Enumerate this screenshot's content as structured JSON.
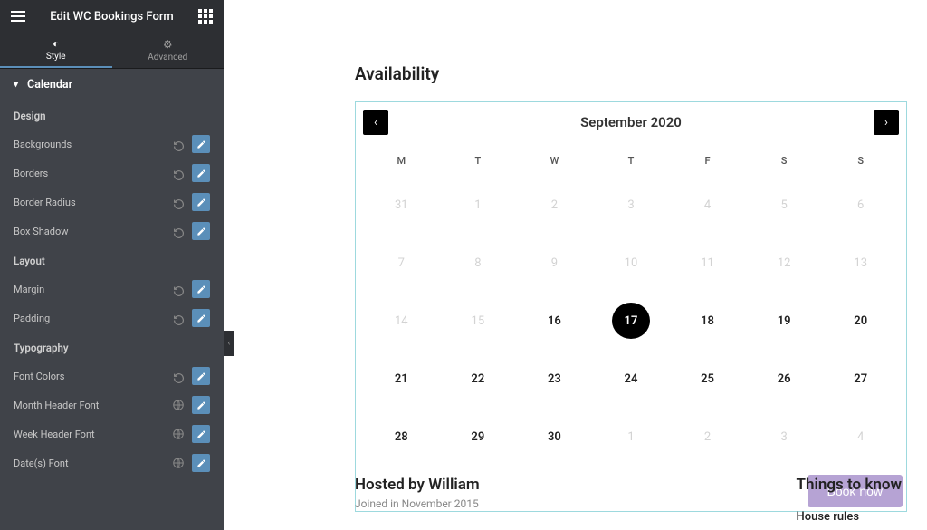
{
  "header": {
    "title": "Edit WC Bookings Form"
  },
  "tabs": {
    "style": "Style",
    "advanced": "Advanced"
  },
  "accordion": {
    "calendar": "Calendar"
  },
  "sections": {
    "design_label": "Design",
    "layout_label": "Layout",
    "typography_label": "Typography"
  },
  "props": {
    "backgrounds": "Backgrounds",
    "borders": "Borders",
    "border_radius": "Border Radius",
    "box_shadow": "Box Shadow",
    "margin": "Margin",
    "padding": "Padding",
    "font_colors": "Font Colors",
    "month_header_font": "Month Header Font",
    "week_header_font": "Week Header Font",
    "dates_font": "Date(s) Font"
  },
  "canvas": {
    "availability": "Availability",
    "month": "September 2020",
    "day_headers": [
      "M",
      "T",
      "W",
      "T",
      "F",
      "S",
      "S"
    ],
    "days": [
      {
        "n": "31",
        "s": "disabled"
      },
      {
        "n": "1",
        "s": "disabled"
      },
      {
        "n": "2",
        "s": "disabled"
      },
      {
        "n": "3",
        "s": "disabled"
      },
      {
        "n": "4",
        "s": "disabled"
      },
      {
        "n": "5",
        "s": "disabled"
      },
      {
        "n": "6",
        "s": "disabled"
      },
      {
        "n": "7",
        "s": "disabled"
      },
      {
        "n": "8",
        "s": "disabled"
      },
      {
        "n": "9",
        "s": "disabled"
      },
      {
        "n": "10",
        "s": "disabled"
      },
      {
        "n": "11",
        "s": "disabled"
      },
      {
        "n": "12",
        "s": "disabled"
      },
      {
        "n": "13",
        "s": "disabled"
      },
      {
        "n": "14",
        "s": "disabled"
      },
      {
        "n": "15",
        "s": "disabled"
      },
      {
        "n": "16",
        "s": "active"
      },
      {
        "n": "17",
        "s": "selected"
      },
      {
        "n": "18",
        "s": "active"
      },
      {
        "n": "19",
        "s": "active"
      },
      {
        "n": "20",
        "s": "active"
      },
      {
        "n": "21",
        "s": "active"
      },
      {
        "n": "22",
        "s": "active"
      },
      {
        "n": "23",
        "s": "active"
      },
      {
        "n": "24",
        "s": "active"
      },
      {
        "n": "25",
        "s": "active"
      },
      {
        "n": "26",
        "s": "active"
      },
      {
        "n": "27",
        "s": "active"
      },
      {
        "n": "28",
        "s": "active"
      },
      {
        "n": "29",
        "s": "active"
      },
      {
        "n": "30",
        "s": "active"
      },
      {
        "n": "1",
        "s": "disabled"
      },
      {
        "n": "2",
        "s": "disabled"
      },
      {
        "n": "3",
        "s": "disabled"
      },
      {
        "n": "4",
        "s": "disabled"
      }
    ],
    "book_label": "Book now",
    "hosted_title": "Hosted by William",
    "hosted_sub": "Joined in November 2015",
    "things_title": "Things to know",
    "house_rules": "House rules"
  }
}
